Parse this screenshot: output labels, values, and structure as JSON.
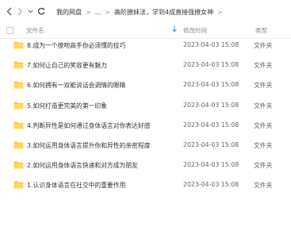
{
  "toolbar": {
    "back_icon": "chevron-left-icon",
    "forward_icon": "chevron-right-icon",
    "dropdown_icon": "chevron-down-icon",
    "refresh_icon": "refresh-icon"
  },
  "breadcrumb": {
    "root": "我的网盘",
    "ellipsis": "...",
    "current": "高阶撩妹法，学到4成直接强撩女神",
    "separator": ">"
  },
  "columns": {
    "name": "文件名",
    "modified": "修改时间",
    "type": "类型",
    "sort_icon": "arrow-down-icon"
  },
  "accent_color": "#3a8ee6",
  "folder_color": "#ffc83d",
  "files": [
    {
      "name": "8.成为一个撩吻高手你必须懂的技巧",
      "modified": "2023-04-03 15:08",
      "type": "文件夹"
    },
    {
      "name": "7.如何让自己的笑容更有魅力",
      "modified": "2023-04-03 15:08",
      "type": "文件夹"
    },
    {
      "name": "6.如何拥有一双能说话会调情的眼睛",
      "modified": "2023-04-03 15:08",
      "type": "文件夹"
    },
    {
      "name": "5.如何打造更完美的第一印象",
      "modified": "2023-04-03 15:08",
      "type": "文件夹"
    },
    {
      "name": "4.判断异性是如何通过身体语言对你表达好感",
      "modified": "2023-04-03 15:08",
      "type": "文件夹"
    },
    {
      "name": "3.如何运用身体语言提升你和异性的亲密程度",
      "modified": "2023-04-03 15:08",
      "type": "文件夹"
    },
    {
      "name": "2.如何运用身体语言快速和对方成为朋友",
      "modified": "2023-04-03 15:08",
      "type": "文件夹"
    },
    {
      "name": "1.认识身体语言在社交中的重要作用",
      "modified": "2023-04-03 15:08",
      "type": "文件夹"
    }
  ]
}
